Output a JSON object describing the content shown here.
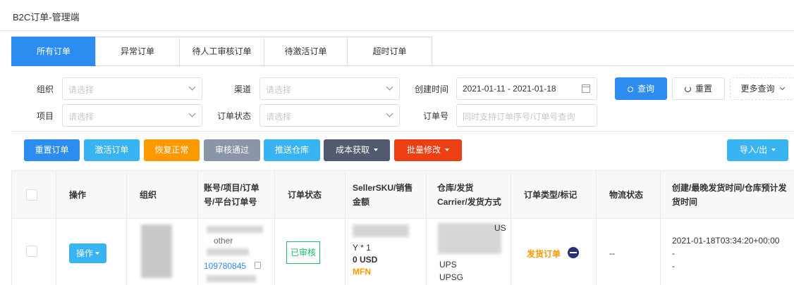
{
  "app": {
    "title": "B2C订单-管理端"
  },
  "tabs": [
    {
      "label": "所有订单",
      "active": true
    },
    {
      "label": "异常订单",
      "active": false
    },
    {
      "label": "待人工审核订单",
      "active": false
    },
    {
      "label": "待激活订单",
      "active": false
    },
    {
      "label": "超时订单",
      "active": false
    }
  ],
  "filters": {
    "org": {
      "label": "组织",
      "placeholder": "请选择"
    },
    "channel": {
      "label": "渠道",
      "placeholder": "请选择"
    },
    "created": {
      "label": "创建时间",
      "value": "2021-01-11 - 2021-01-18"
    },
    "project": {
      "label": "项目",
      "placeholder": "请选择"
    },
    "status": {
      "label": "订单状态",
      "placeholder": "请选择"
    },
    "order_no": {
      "label": "订单号",
      "placeholder": "同时支持订单序号/订单号查询"
    },
    "search_label": "查询",
    "reset_label": "重置",
    "more_label": "更多查询"
  },
  "actions": {
    "reset_order": {
      "label": "重置订单",
      "color": "#2d8cf0"
    },
    "activate": {
      "label": "激活订单",
      "color": "#39b4f2"
    },
    "restore": {
      "label": "恢复正常",
      "color": "#ff9900"
    },
    "approve": {
      "label": "审核通过",
      "color": "#8a95a8"
    },
    "push_wh": {
      "label": "推送仓库",
      "color": "#39b4f2"
    },
    "cost": {
      "label": "成本获取",
      "color": "#515a6e"
    },
    "batch_edit": {
      "label": "批量修改",
      "color": "#ed3f14"
    },
    "import_export": {
      "label": "导入/出",
      "color": "#39b4f2"
    }
  },
  "table": {
    "headers": {
      "op": "操作",
      "org": "组织",
      "account": "账号/项目/订单号/平台订单号",
      "status": "订单状态",
      "sku": "SellerSKU/销售金额",
      "warehouse": "仓库/发货Carrier/发货方式",
      "type": "订单类型/标记",
      "logistics": "物流状态",
      "times": "创建/最晚发货时间/仓库预计发货时间"
    },
    "rows": [
      {
        "op_label": "操作",
        "account_line2": "other",
        "order_no": "109780845",
        "status": "已审核",
        "qty": "Y * 1",
        "amount": "0 USD",
        "fulfillment": "MFN",
        "warehouse_us": "US",
        "carrier": "UPS",
        "ship_method": "UPSG",
        "order_type": "发货订单",
        "logistics": "--",
        "created": "2021-01-18T03:34:20+00:00",
        "latest_ship": "-",
        "wh_est_ship": "-"
      }
    ]
  }
}
